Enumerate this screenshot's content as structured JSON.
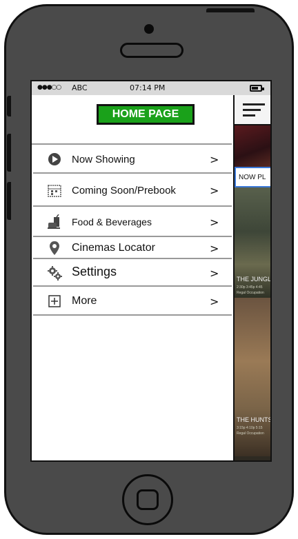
{
  "status_bar": {
    "signal": "●●●○○",
    "carrier": "ABC",
    "time": "07:14 PM"
  },
  "header": {
    "title": "HOME PAGE",
    "accent_color": "#1aa11a"
  },
  "menu": {
    "items": [
      {
        "label": "Now Showing",
        "icon": "play-circle-icon",
        "chevron": ">"
      },
      {
        "label": "Coming Soon/Prebook",
        "icon": "calendar-icon",
        "chevron": ">"
      },
      {
        "label": "Food & Beverages",
        "icon": "food-drink-icon",
        "chevron": ">"
      },
      {
        "label": "Cinemas Locator",
        "icon": "map-pin-icon",
        "chevron": ">"
      },
      {
        "label": "Settings",
        "icon": "gears-icon",
        "chevron": ">"
      },
      {
        "label": "More",
        "icon": "plus-box-icon",
        "chevron": ">"
      }
    ]
  },
  "right_panel": {
    "tab_label": "NOW PL",
    "movie1_title": "THE JUNGL",
    "movie1_line1": "2:30p 3:45p 4:45",
    "movie1_line2": "Regal Occupation",
    "movie2_title": "THE HUNTS",
    "movie2_line1": "3:15p 4:10p 5:15",
    "movie2_line2": "Regal Occupation"
  }
}
